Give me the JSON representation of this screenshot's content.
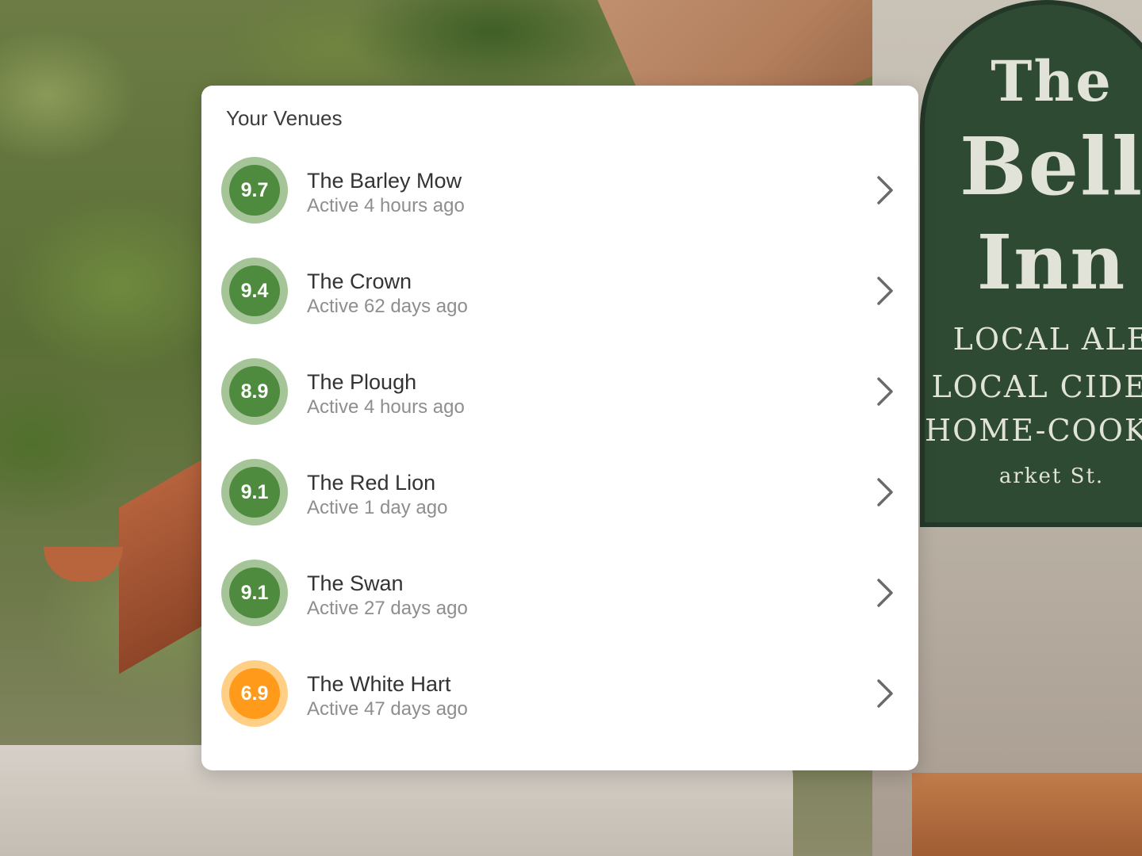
{
  "card": {
    "title": "Your Venues"
  },
  "colors": {
    "good_ring": "#a5c497",
    "good_fill": "#4e8b3e",
    "warn_ring": "#ffcf86",
    "warn_fill": "#ff9a1a",
    "chevron": "#6a6a6a"
  },
  "venues": [
    {
      "score": "9.7",
      "name": "The Barley Mow",
      "active": "Active 4 hours ago",
      "rating": "good"
    },
    {
      "score": "9.4",
      "name": "The Crown",
      "active": "Active 62 days ago",
      "rating": "good"
    },
    {
      "score": "8.9",
      "name": "The Plough",
      "active": "Active 4 hours ago",
      "rating": "good"
    },
    {
      "score": "9.1",
      "name": "The Red Lion",
      "active": "Active 1 day ago",
      "rating": "good"
    },
    {
      "score": "9.1",
      "name": "The Swan",
      "active": "Active 27 days ago",
      "rating": "good"
    },
    {
      "score": "6.9",
      "name": "The White Hart",
      "active": "Active 47 days ago",
      "rating": "warn"
    }
  ],
  "background_sign": {
    "line1": "The",
    "line2": "Bell",
    "line3": "Inn",
    "line4": "LOCAL ALE",
    "line5": "LOCAL CIDER",
    "line6": "HOME-COOKED",
    "line7": "arket St."
  },
  "icons": {
    "row_chevron": "chevron-right-icon"
  }
}
